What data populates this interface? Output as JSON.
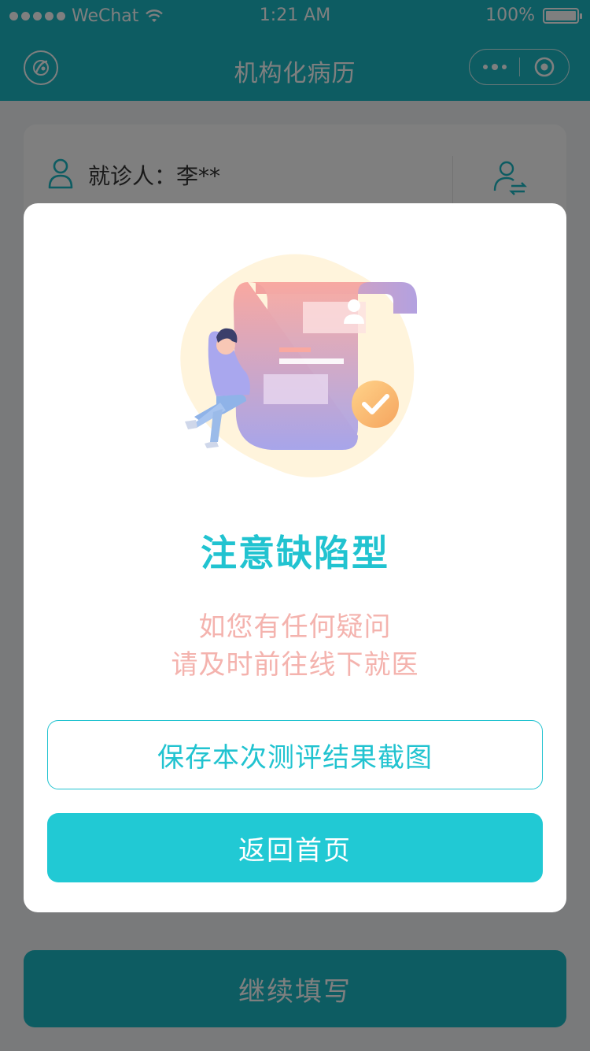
{
  "status_bar": {
    "carrier": "WeChat",
    "time": "1:21 AM",
    "battery": "100%"
  },
  "nav": {
    "title": "机构化病历",
    "logo_icon": "app-logo-icon",
    "more_icon": "more-dots-icon",
    "close_icon": "target-close-icon"
  },
  "patient": {
    "label": "就诊人：李**",
    "person_icon": "person-icon",
    "switch_icon": "switch-user-icon"
  },
  "modal": {
    "result_title": "注意缺陷型",
    "advice_line1": "如您有任何疑问",
    "advice_line2": "请及时前往线下就医",
    "save_button": "保存本次测评结果截图",
    "home_button": "返回首页",
    "illustration": "medical-record-illustration"
  },
  "footer": {
    "continue_button": "继续填写"
  },
  "colors": {
    "brand": "#1bb8c4",
    "accent": "#21c3d0",
    "advice_text": "#f4b3ae"
  }
}
